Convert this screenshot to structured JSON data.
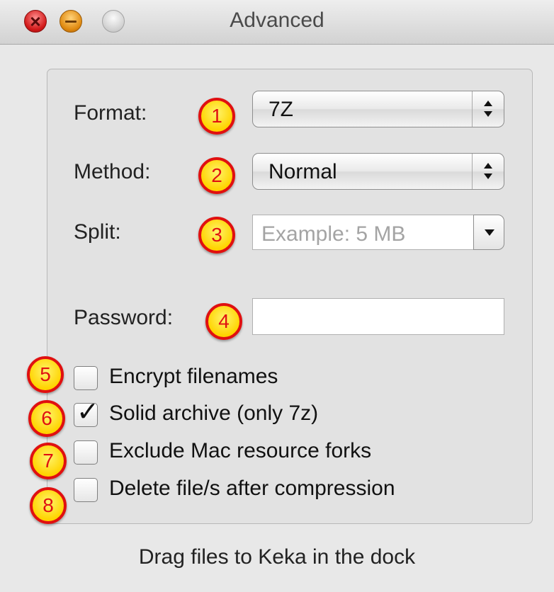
{
  "window": {
    "title": "Advanced"
  },
  "form": {
    "format": {
      "label": "Format:",
      "value": "7Z",
      "badge": "1"
    },
    "method": {
      "label": "Method:",
      "value": "Normal",
      "badge": "2"
    },
    "split": {
      "label": "Split:",
      "placeholder": "Example: 5 MB",
      "badge": "3"
    },
    "password": {
      "label": "Password:",
      "value": "",
      "badge": "4"
    }
  },
  "options": [
    {
      "label": "Encrypt filenames",
      "checked": false,
      "badge": "5"
    },
    {
      "label": "Solid archive (only 7z)",
      "checked": true,
      "badge": "6"
    },
    {
      "label": "Exclude Mac resource forks",
      "checked": false,
      "badge": "7"
    },
    {
      "label": "Delete file/s after compression",
      "checked": false,
      "badge": "8"
    }
  ],
  "footer": {
    "hint": "Drag files to Keka in the dock"
  },
  "colors": {
    "badge_fill": "#ffd400",
    "badge_ring": "#e01010",
    "placeholder": "#a4a4a4"
  }
}
